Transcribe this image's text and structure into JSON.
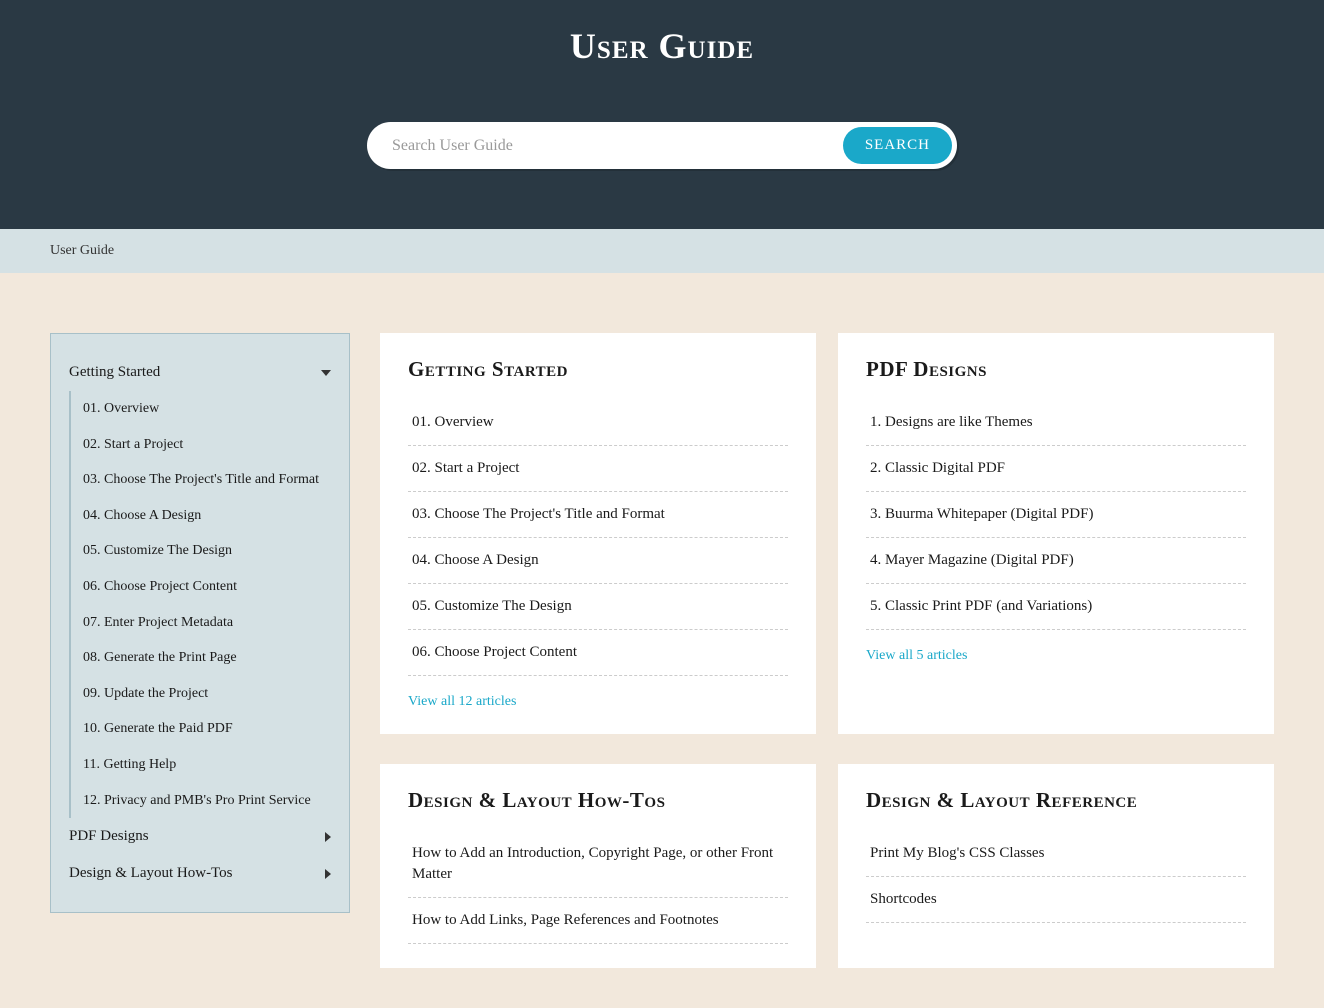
{
  "header": {
    "title": "User Guide",
    "search_placeholder": "Search User Guide",
    "search_button": "SEARCH"
  },
  "breadcrumb": "User Guide",
  "sidebar": {
    "sections": [
      {
        "label": "Getting Started",
        "expanded": true,
        "items": [
          "01. Overview",
          "02. Start a Project",
          "03. Choose The Project's Title and Format",
          "04. Choose A Design",
          "05. Customize The Design",
          "06. Choose Project Content",
          "07. Enter Project Metadata",
          "08. Generate the Print Page",
          "09. Update the Project",
          "10. Generate the Paid PDF",
          "11. Getting Help",
          "12. Privacy and PMB's Pro Print Service"
        ]
      },
      {
        "label": "PDF Designs",
        "expanded": false,
        "items": []
      },
      {
        "label": "Design & Layout How-Tos",
        "expanded": false,
        "items": []
      }
    ]
  },
  "cards": [
    {
      "title": "Getting Started",
      "items": [
        "01. Overview",
        "02. Start a Project",
        "03. Choose The Project's Title and Format",
        "04. Choose A Design",
        "05. Customize The Design",
        "06. Choose Project Content"
      ],
      "view_all": "View all 12 articles"
    },
    {
      "title": "PDF Designs",
      "items": [
        "1. Designs are like Themes",
        "2. Classic Digital PDF",
        "3. Buurma Whitepaper (Digital PDF)",
        "4. Mayer Magazine (Digital PDF)",
        "5. Classic Print PDF (and Variations)"
      ],
      "view_all": "View all 5 articles"
    },
    {
      "title": "Design & Layout How-Tos",
      "items": [
        "How to Add an Introduction, Copyright Page, or other Front Matter",
        "How to Add Links, Page References and Footnotes"
      ],
      "view_all": ""
    },
    {
      "title": "Design & Layout Reference",
      "items": [
        "Print My Blog's CSS Classes",
        "Shortcodes"
      ],
      "view_all": ""
    }
  ]
}
